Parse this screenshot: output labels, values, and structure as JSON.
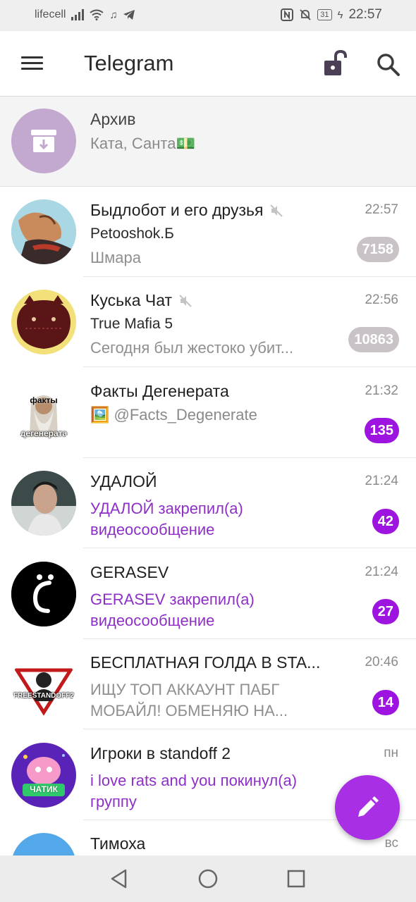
{
  "status_bar": {
    "carrier": "lifecell",
    "battery": "31",
    "time": "22:57"
  },
  "app_bar": {
    "title": "Telegram"
  },
  "archive": {
    "title": "Архив",
    "subtitle": "Ката, Санта💵"
  },
  "chats": [
    {
      "name": "Быдлобот и его друзья",
      "muted": true,
      "time": "22:57",
      "sender": "Petooshok.Б",
      "message": "Шмара",
      "badge": "7158"
    },
    {
      "name": "Куська Чат",
      "muted": true,
      "time": "22:56",
      "sender": "True Mafia 5",
      "message": "Сегодня был жестоко убит...",
      "badge": "10863"
    },
    {
      "name": "Факты Дегенерата",
      "time": "21:32",
      "message": "🖼️ @Facts_Degenerate",
      "badge": "135",
      "avatar_caption_top": "факты",
      "avatar_caption_bottom": "дегенерата"
    },
    {
      "name": "УДАЛОЙ",
      "time": "21:24",
      "message": "УДАЛОЙ закрепил(а) видеосообщение",
      "badge": "42"
    },
    {
      "name": "GERASEV",
      "time": "21:24",
      "message": "GERASEV закрепил(а) видеосообщение",
      "badge": "27"
    },
    {
      "name": "БЕСПЛАТНАЯ ГОЛДА В STA...",
      "time": "20:46",
      "message": "ИЩУ ТОП АККАУНТ ПАБГ МОБАЙЛ! ОБМЕНЯЮ НА...",
      "badge": "14",
      "avatar_caption": "FREESTANDOFF2"
    },
    {
      "name": "Игроки в standoff 2",
      "time": "пн",
      "message": "i love rats and you покинул(а) группу",
      "avatar_caption": "ЧАТИК"
    },
    {
      "name": "Тимоха",
      "time": "вс"
    }
  ],
  "colors": {
    "accent": "#9d14e0",
    "fab": "#a92fe4",
    "muted_badge": "#c9c3c8",
    "archive_avatar": "#c3a8cf"
  }
}
